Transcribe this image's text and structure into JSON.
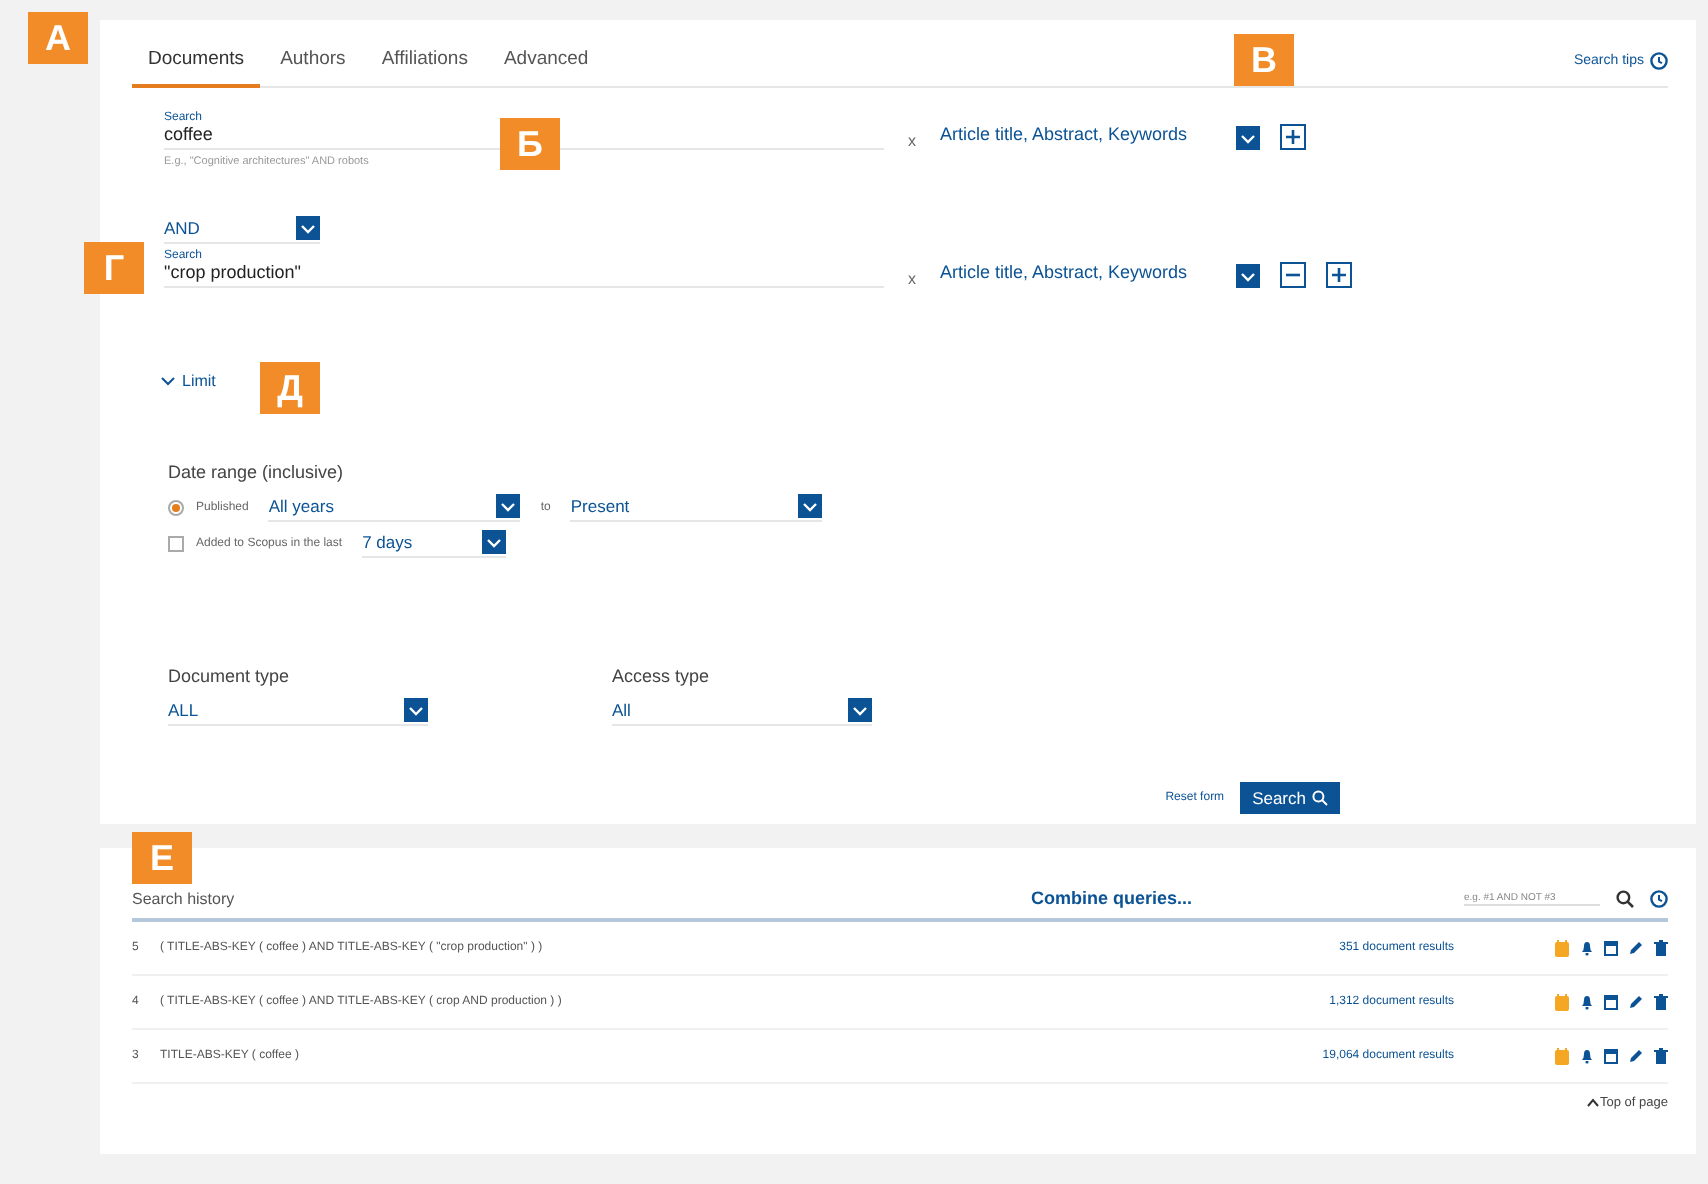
{
  "annotations": [
    {
      "label": "А"
    },
    {
      "label": "Б"
    },
    {
      "label": "В"
    },
    {
      "label": "Г"
    },
    {
      "label": "Д"
    },
    {
      "label": "Е"
    }
  ],
  "tabs": [
    {
      "label": "Documents",
      "selected": true
    },
    {
      "label": "Authors",
      "selected": false
    },
    {
      "label": "Affiliations",
      "selected": false
    },
    {
      "label": "Advanced",
      "selected": false
    }
  ],
  "search_tips": "Search tips",
  "search_rows": [
    {
      "operator": null,
      "label": "Search",
      "value": "coffee",
      "hint": "E.g., \"Cognitive architectures\" AND robots",
      "clear": "x",
      "field": "Article title, Abstract, Keywords",
      "actions": [
        {
          "kind": "add"
        }
      ]
    },
    {
      "operator": "AND",
      "label": "Search",
      "value": "\"crop production\"",
      "hint": null,
      "clear": "x",
      "field": "Article title, Abstract, Keywords",
      "actions": [
        {
          "kind": "remove"
        },
        {
          "kind": "add"
        }
      ]
    }
  ],
  "limit": {
    "label": "Limit",
    "expanded": true
  },
  "date_range": {
    "title": "Date range (inclusive)",
    "published": {
      "label": "Published",
      "selected": true,
      "from": "All years",
      "to_label": "to",
      "to": "Present"
    },
    "added": {
      "label": "Added to Scopus in the last",
      "checked": false,
      "period": "7 days"
    }
  },
  "document_type": {
    "label": "Document type",
    "value": "ALL"
  },
  "access_type": {
    "label": "Access type",
    "value": "All"
  },
  "reset": "Reset form",
  "search_button": "Search",
  "history": {
    "title": "Search history",
    "combine": "Combine queries...",
    "placeholder": "e.g. #1 AND NOT #3",
    "rows": [
      {
        "number": "5",
        "query": "( TITLE-ABS-KEY ( coffee ) AND TITLE-ABS-KEY ( \"crop production\" ) )",
        "results": "351 document results"
      },
      {
        "number": "4",
        "query": "( TITLE-ABS-KEY ( coffee ) AND TITLE-ABS-KEY ( crop AND production ) )",
        "results": "1,312 document results"
      },
      {
        "number": "3",
        "query": "TITLE-ABS-KEY ( coffee )",
        "results": "19,064 document results"
      }
    ],
    "top_link": "Top of page"
  }
}
